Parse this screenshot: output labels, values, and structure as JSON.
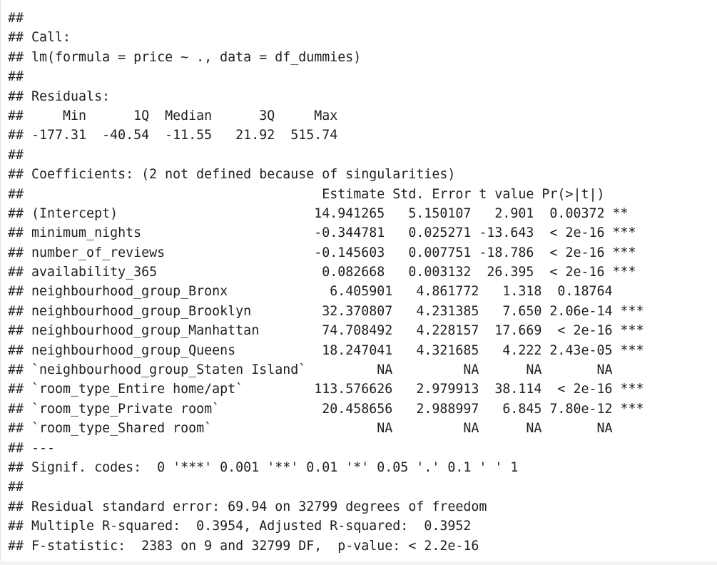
{
  "lines": [
    "##",
    "## Call:",
    "## lm(formula = price ~ ., data = df_dummies)",
    "##",
    "## Residuals:",
    "##     Min      1Q  Median      3Q     Max",
    "## -177.31  -40.54  -11.55   21.92  515.74",
    "##",
    "## Coefficients: (2 not defined because of singularities)",
    "##                                      Estimate Std. Error t value Pr(>|t|)",
    "## (Intercept)                         14.941265   5.150107   2.901  0.00372 **",
    "## minimum_nights                      -0.344781   0.025271 -13.643  < 2e-16 ***",
    "## number_of_reviews                   -0.145603   0.007751 -18.786  < 2e-16 ***",
    "## availability_365                     0.082668   0.003132  26.395  < 2e-16 ***",
    "## neighbourhood_group_Bronx             6.405901   4.861772   1.318  0.18764",
    "## neighbourhood_group_Brooklyn         32.370807   4.231385   7.650 2.06e-14 ***",
    "## neighbourhood_group_Manhattan        74.708492   4.228157  17.669  < 2e-16 ***",
    "## neighbourhood_group_Queens           18.247041   4.321685   4.222 2.43e-05 ***",
    "## `neighbourhood_group_Staten Island`         NA         NA      NA       NA",
    "## `room_type_Entire home/apt`         113.576626   2.979913  38.114  < 2e-16 ***",
    "## `room_type_Private room`             20.458656   2.988997   6.845 7.80e-12 ***",
    "## `room_type_Shared room`                     NA         NA      NA       NA",
    "## ---",
    "## Signif. codes:  0 '***' 0.001 '**' 0.01 '*' 0.05 '.' 0.1 ' ' 1",
    "##",
    "## Residual standard error: 69.94 on 32799 degrees of freedom",
    "## Multiple R-squared:  0.3954, Adjusted R-squared:  0.3952",
    "## F-statistic:  2383 on 9 and 32799 DF,  p-value: < 2.2e-16"
  ]
}
